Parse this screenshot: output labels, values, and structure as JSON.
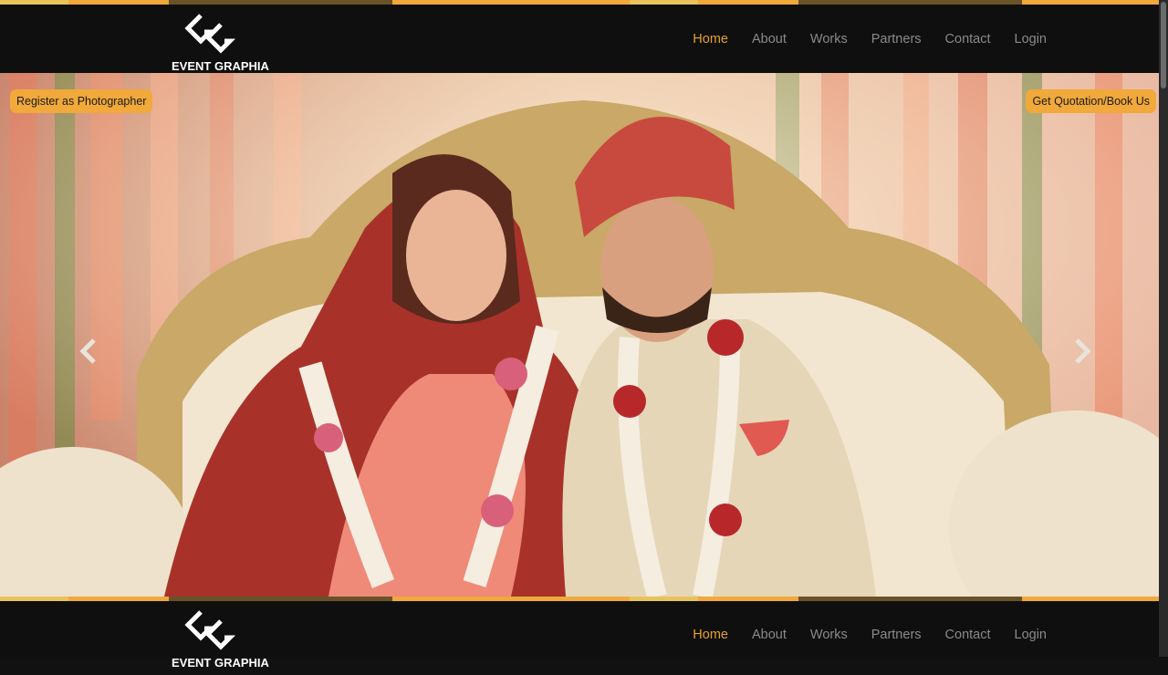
{
  "header": {
    "logo_text": "EVENT GRAPHIA",
    "nav": [
      "Home",
      "About",
      "Works",
      "Partners",
      "Contact",
      "Login"
    ],
    "active": "Home"
  },
  "hero": {
    "register_label": "Register as Photographer",
    "quote_label": "Get Quotation/Book Us",
    "prev_icon": "chevron-left-icon",
    "next_icon": "chevron-right-icon"
  },
  "sticky_header": {
    "nav": [
      "Home",
      "About",
      "Works",
      "Partners",
      "Contact",
      "Login"
    ],
    "active": "Home"
  },
  "colors": {
    "accent": "#e8a028",
    "nav_bg": "#0f0f0f",
    "stripe_gold": "#f0a93a",
    "stripe_dark": "#5a4a2a"
  }
}
